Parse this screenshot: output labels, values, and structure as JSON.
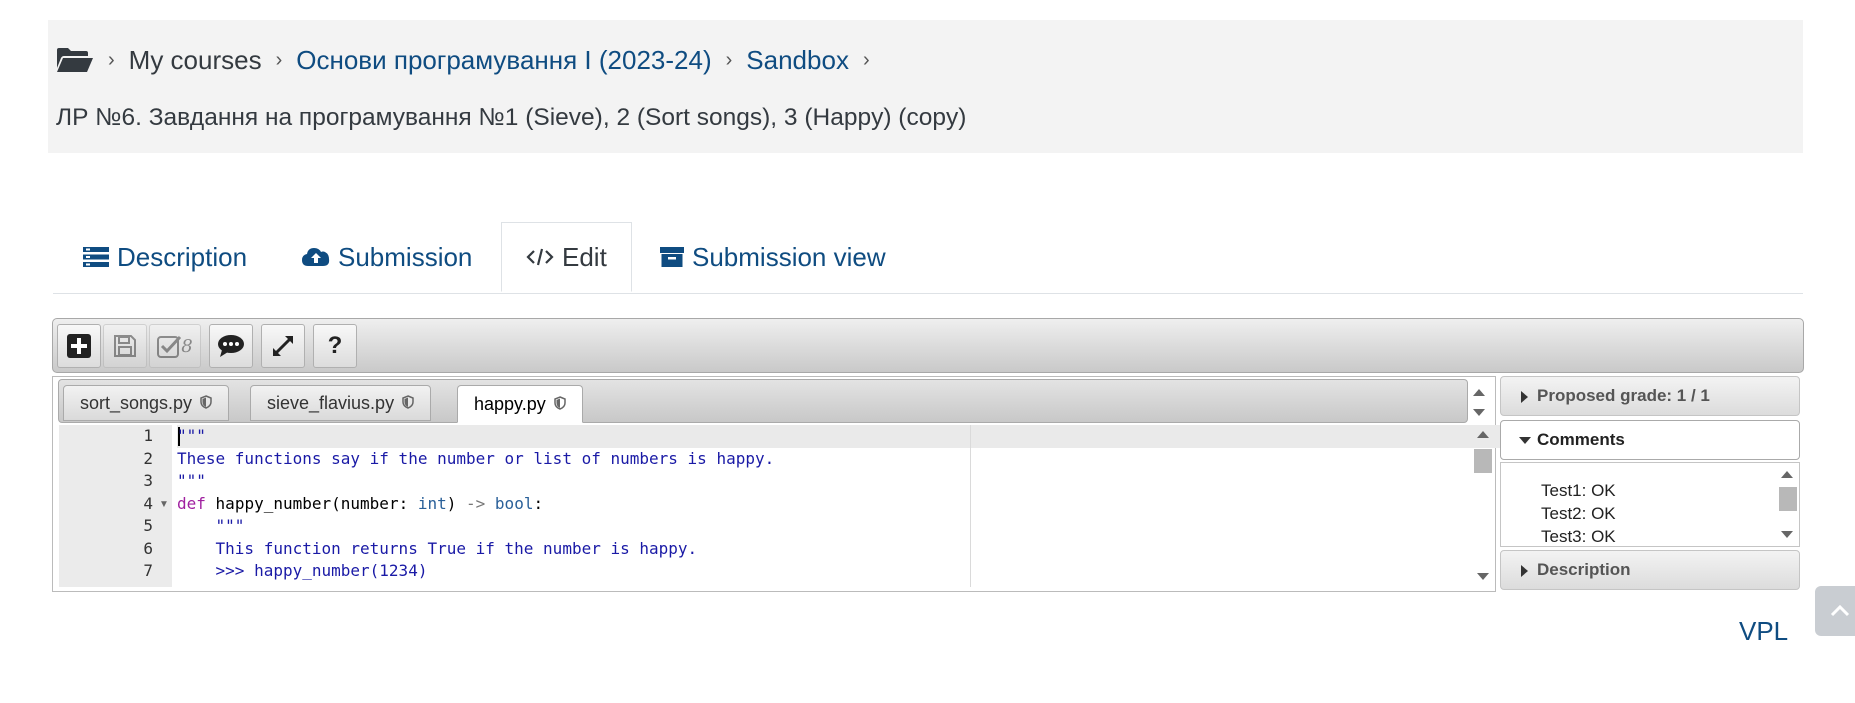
{
  "breadcrumb": {
    "items": [
      "My courses",
      "Основи програмування I (2023-24)",
      "Sandbox"
    ]
  },
  "page_title": "ЛР №6. Завдання на програмування №1 (Sieve), 2 (Sort songs), 3 (Happy) (copy)",
  "tabs": [
    {
      "label": "Description",
      "icon": "list-icon"
    },
    {
      "label": "Submission",
      "icon": "cloud-upload-icon"
    },
    {
      "label": "Edit",
      "icon": "code-icon",
      "active": true
    },
    {
      "label": "Submission view",
      "icon": "archive-icon"
    }
  ],
  "toolbar": {
    "buttons": [
      "new-file",
      "save",
      "evaluate",
      "comments",
      "fullscreen",
      "help"
    ],
    "evaluate_count": "8",
    "help_label": "?"
  },
  "files": [
    {
      "name": "sort_songs.py",
      "active": false
    },
    {
      "name": "sieve_flavius.py",
      "active": false
    },
    {
      "name": "happy.py",
      "active": true
    }
  ],
  "editor": {
    "line_numbers": [
      "1",
      "2",
      "3",
      "4",
      "5",
      "6",
      "7"
    ],
    "lines": [
      "\"\"\"",
      "These functions say if the number or list of numbers is happy.",
      "\"\"\"",
      "def happy_number(number: int) -> bool:",
      "    \"\"\"",
      "    This function returns True if the number is happy.",
      "    >>> happy_number(1234)"
    ]
  },
  "side": {
    "proposed_grade": "Proposed grade: 1 / 1",
    "comments_title": "Comments",
    "comments": [
      "Test1: OK",
      "Test2: OK",
      "Test3: OK"
    ],
    "description_title": "Description"
  },
  "footer": {
    "vpl_link": "VPL"
  },
  "colors": {
    "link": "#0f4c81",
    "header_bg": "#f3f3f3"
  }
}
